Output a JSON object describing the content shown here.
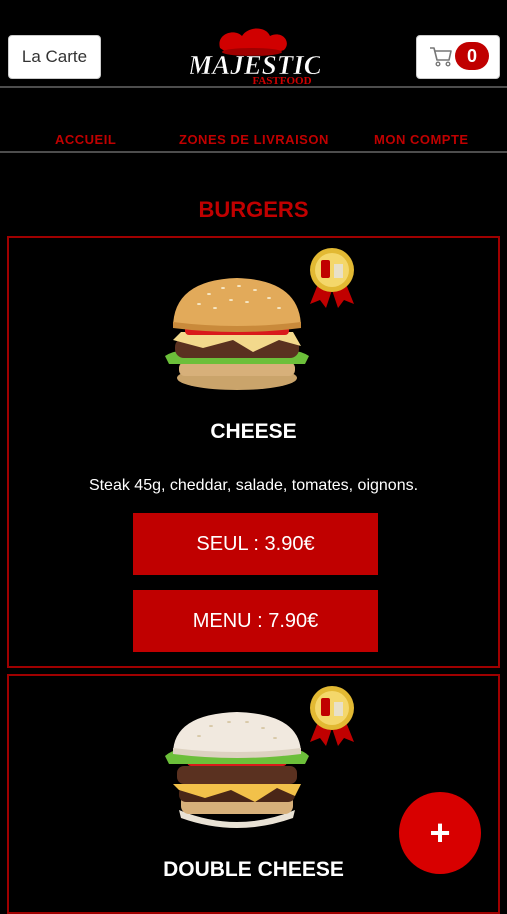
{
  "header": {
    "carte_label": "La Carte",
    "logo_text": "MAJESTIC",
    "logo_sub": "FASTFOOD",
    "cart_count": "0"
  },
  "nav": {
    "items": [
      {
        "label": "ACCUEIL"
      },
      {
        "label": "ZONES DE LIVRAISON"
      },
      {
        "label": "MON COMPTE"
      }
    ]
  },
  "section": {
    "title": "BURGERS"
  },
  "products": [
    {
      "name": "CHEESE",
      "description": "Steak 45g, cheddar, salade, tomates, oignons.",
      "seul_label": "SEUL : 3.90€",
      "menu_label": "MENU : 7.90€"
    },
    {
      "name": "DOUBLE CHEESE"
    }
  ],
  "fab": {
    "label": "+"
  },
  "colors": {
    "accent": "#c00000",
    "background": "#000000"
  }
}
